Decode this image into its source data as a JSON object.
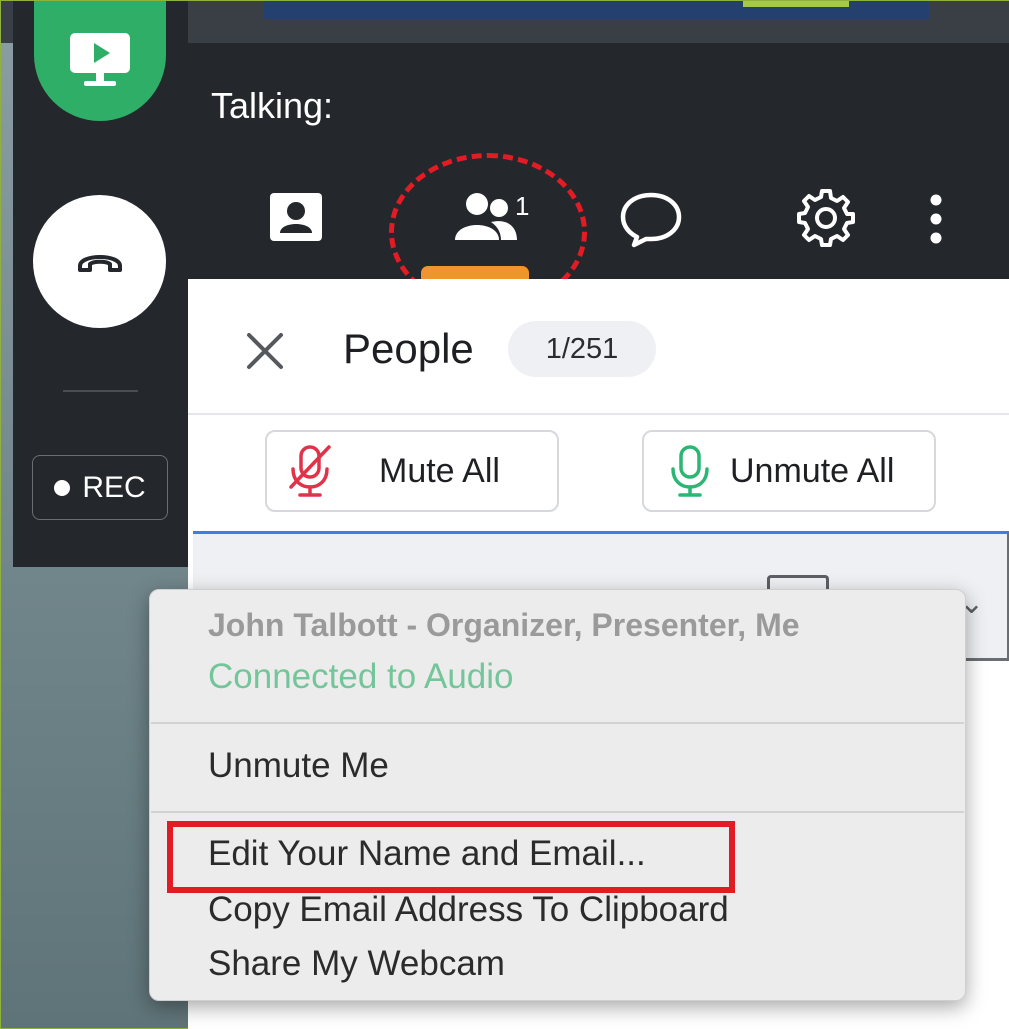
{
  "header": {
    "talking_label": "Talking:"
  },
  "tabs": [
    {
      "name": "contact",
      "icon": "contact-card-icon"
    },
    {
      "name": "people",
      "icon": "people-icon",
      "badge": "1",
      "active": true
    },
    {
      "name": "chat",
      "icon": "chat-bubble-icon"
    },
    {
      "name": "settings",
      "icon": "gear-icon"
    },
    {
      "name": "more",
      "icon": "more-vertical-icon"
    }
  ],
  "left_toolbar": {
    "rec_label": "REC"
  },
  "people_panel": {
    "title": "People",
    "count": "1/251",
    "mute_all_label": "Mute All",
    "unmute_all_label": "Unmute All"
  },
  "context_menu": {
    "user_name": "John Talbott - Organizer, Presenter, Me",
    "audio_status": "Connected to Audio",
    "items": [
      "Unmute Me",
      "Edit Your Name and Email...",
      "Copy Email Address To Clipboard",
      "Share My Webcam"
    ]
  },
  "colors": {
    "share_green": "#2fae67",
    "active_tab_orange": "#f0942e",
    "mute_red": "#e0334a",
    "unmute_green": "#2bb673",
    "audio_status_green": "#74c69a",
    "highlight_red": "#e21b24"
  }
}
